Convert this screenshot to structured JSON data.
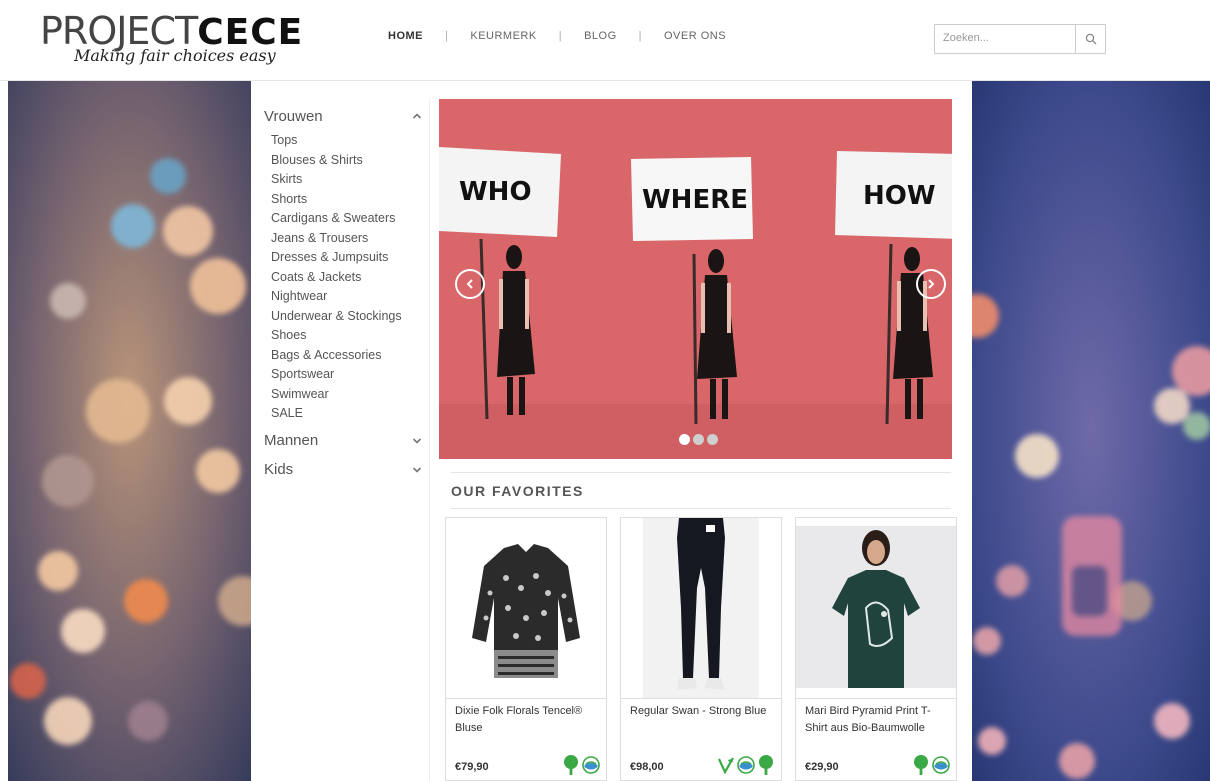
{
  "brand": {
    "logo_thin": "PROJECT",
    "logo_bold": "CECE",
    "tagline": "Making fair choices easy"
  },
  "nav": {
    "items": [
      {
        "label": "HOME",
        "active": true
      },
      {
        "label": "KEURMERK",
        "active": false
      },
      {
        "label": "BLOG",
        "active": false
      },
      {
        "label": "OVER ONS",
        "active": false
      }
    ],
    "separator": "|"
  },
  "search": {
    "placeholder": "Zoeken...",
    "icon": "search-icon"
  },
  "sidebar": {
    "categories": [
      {
        "label": "Vrouwen",
        "expanded": true,
        "icon": "chevron-up-icon",
        "items": [
          "Tops",
          "Blouses & Shirts",
          "Skirts",
          "Shorts",
          "Cardigans & Sweaters",
          "Jeans & Trousers",
          "Dresses & Jumpsuits",
          "Coats & Jackets",
          "Nightwear",
          "Underwear & Stockings",
          "Shoes",
          "Bags & Accessories",
          "Sportswear",
          "Swimwear",
          "SALE"
        ]
      },
      {
        "label": "Mannen",
        "expanded": false,
        "icon": "chevron-down-icon",
        "items": []
      },
      {
        "label": "Kids",
        "expanded": false,
        "icon": "chevron-down-icon",
        "items": []
      }
    ]
  },
  "hero": {
    "signs": [
      "WHO",
      "WHERE",
      "HOW"
    ],
    "prev_icon": "chevron-left-icon",
    "next_icon": "chevron-right-icon",
    "slide_count": 3,
    "active_slide": 1,
    "colors": {
      "backdrop": "#d9676a"
    }
  },
  "favorites": {
    "title": "OUR FAVORITES",
    "products": [
      {
        "name": "Dixie Folk Florals Tencel® Bluse",
        "price": "€79,90",
        "badges": [
          "tree-icon",
          "earth-icon"
        ]
      },
      {
        "name": "Regular Swan - Strong Blue",
        "price": "€98,00",
        "badges": [
          "vegan-leaf-icon",
          "earth-icon",
          "tree-icon"
        ]
      },
      {
        "name": "Mari Bird Pyramid Print T-Shirt aus Bio-Baumwolle",
        "price": "€29,90",
        "badges": [
          "tree-icon",
          "earth-icon"
        ]
      }
    ]
  },
  "colors": {
    "badge_green": "#3aa845",
    "badge_blue": "#3b8fd0",
    "text": "#555555"
  }
}
